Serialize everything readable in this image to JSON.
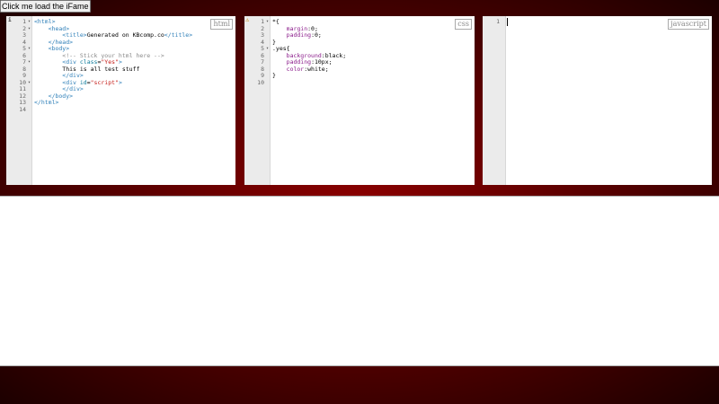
{
  "load_button": "Click me load the iFame",
  "editors": {
    "html": {
      "label": "html",
      "line_numbers": [
        "1",
        "2",
        "3",
        "4",
        "5",
        "6",
        "7",
        "8",
        "9",
        "10",
        "11",
        "12",
        "13",
        "14"
      ],
      "lines": [
        [
          "<html>"
        ],
        [
          "    <head>"
        ],
        [
          "        <title>",
          "Generated on KBcomp.co",
          "</title>"
        ],
        [
          "    </head>"
        ],
        [
          "    <body>"
        ],
        [
          "        <!-- Stick your html here -->"
        ],
        [
          "        <div ",
          "class",
          "=",
          "\"Yes\"",
          ">"
        ],
        [
          "        This is all test stuff"
        ],
        [
          "        </div>"
        ],
        [
          "        <div ",
          "id",
          "=",
          "\"script\"",
          ">"
        ],
        [
          "        </div>"
        ],
        [
          "    </body>"
        ],
        [
          "</html>"
        ],
        [
          ""
        ]
      ]
    },
    "css": {
      "label": "css",
      "line_numbers": [
        "1",
        "2",
        "3",
        "4",
        "5",
        "6",
        "7",
        "8",
        "9",
        "10"
      ],
      "lines": [
        [
          "*{"
        ],
        [
          "    ",
          "margin",
          ":0;"
        ],
        [
          "    ",
          "padding",
          ":0;"
        ],
        [
          "}"
        ],
        [
          ".yes{"
        ],
        [
          "    ",
          "background",
          ":black;"
        ],
        [
          "    ",
          "padding",
          ":10px;"
        ],
        [
          "    ",
          "color",
          ":white;"
        ],
        [
          "}"
        ],
        [
          ""
        ]
      ]
    },
    "javascript": {
      "label": "javascript",
      "line_numbers": [
        "1"
      ],
      "lines": [
        [
          ""
        ]
      ]
    }
  }
}
